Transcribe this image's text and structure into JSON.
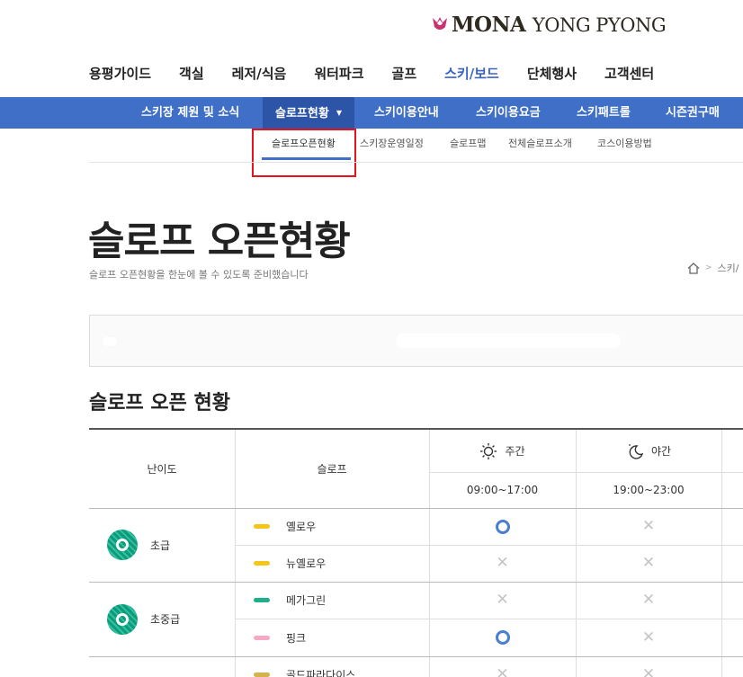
{
  "brand": {
    "logo_main": "MONA",
    "logo_sub": "YONG PYONG",
    "accent": "#3f6fc7"
  },
  "gnb": [
    "용평가이드",
    "객실",
    "레저/식음",
    "워터파크",
    "골프",
    "스키/보드",
    "단체행사",
    "고객센터"
  ],
  "subbar": {
    "items": [
      "스키장 제원 및 소식",
      "슬로프현황",
      "스키이용안내",
      "스키이용요금",
      "스키패트롤",
      "시즌권구매"
    ],
    "caret": "▼"
  },
  "lnb": [
    "슬로프오픈현황",
    "스키장운영일정",
    "슬로프맵",
    "전체슬로프소개",
    "코스이용방법"
  ],
  "page": {
    "title": "슬로프 오픈현황",
    "desc": "슬로프 오픈현황을 한눈에 볼 수 있도록 준비했습니다",
    "crumb_sep": ">",
    "crumb_next": "스키/"
  },
  "section_title": "슬로프 오픈 현황",
  "table": {
    "headers": {
      "level": "난이도",
      "slope": "슬로프",
      "day": "주간",
      "day_time": "09:00~17:00",
      "night": "야간",
      "night_time": "19:00~23:00"
    },
    "groups": [
      {
        "level": "초급",
        "rows": [
          {
            "name": "옐로우",
            "color": "#f5c518",
            "day": "open",
            "night": "closed"
          },
          {
            "name": "뉴옐로우",
            "color": "#f5c518",
            "day": "closed",
            "night": "closed"
          }
        ]
      },
      {
        "level": "초중급",
        "rows": [
          {
            "name": "메가그린",
            "color": "#1fae8a",
            "day": "closed",
            "night": "closed"
          },
          {
            "name": "핑크",
            "color": "#f7a8c4",
            "day": "open",
            "night": "closed"
          }
        ]
      }
    ],
    "partial_row": {
      "name": "골드파라다이스",
      "color": "#d4b24c"
    }
  },
  "marks": {
    "closed": "✕"
  }
}
